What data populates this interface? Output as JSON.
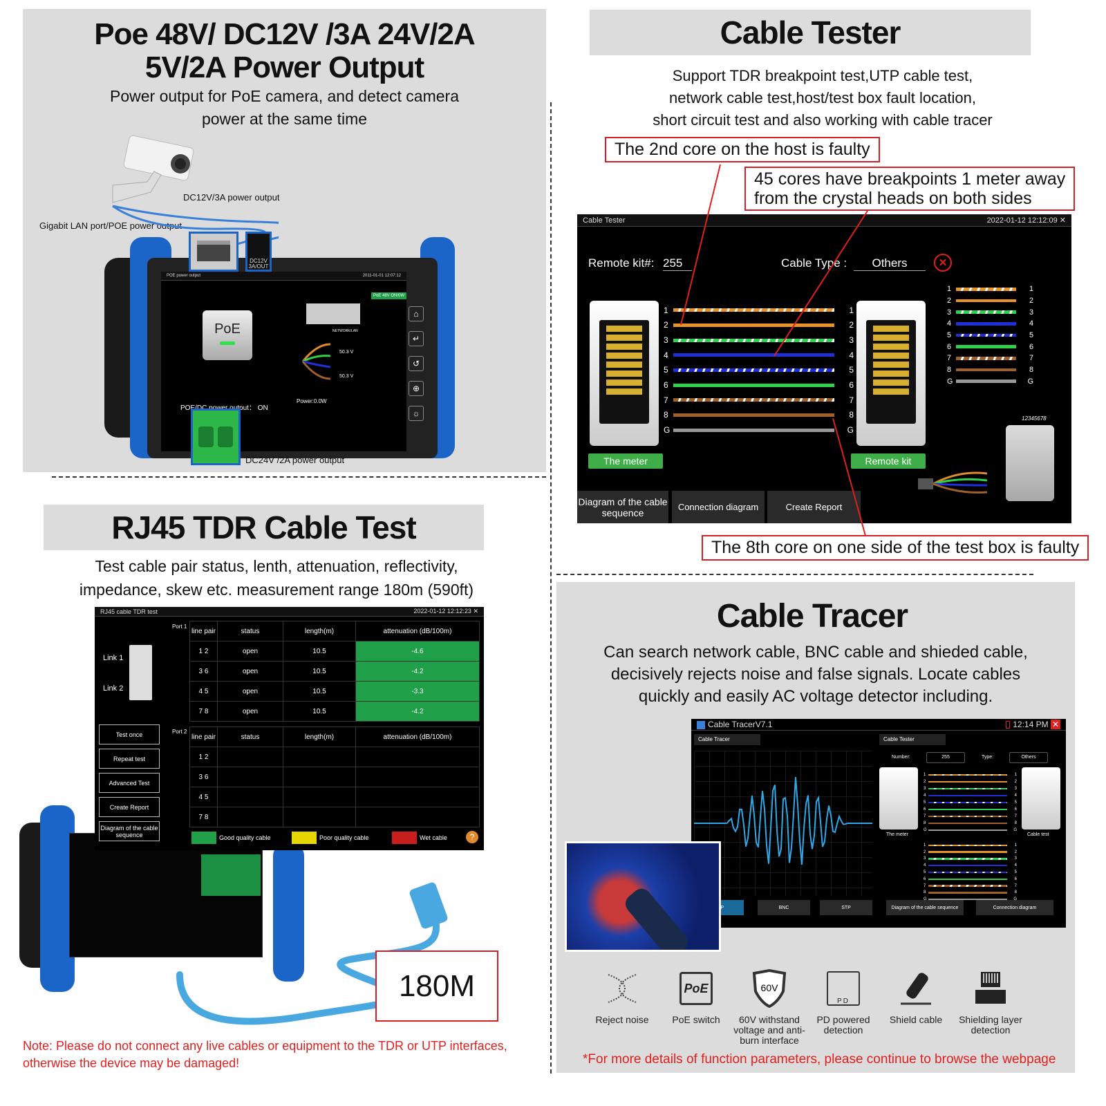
{
  "poe_section": {
    "title_line1": "Poe  48V/ DC12V /3A  24V/2A",
    "title_line2": "5V/2A  Power Output",
    "subtitle_line1": "Power output for PoE camera, and detect camera",
    "subtitle_line2": "power at the same time",
    "labels": {
      "dc12v": "DC12V/3A power output",
      "gigabit": "Gigabit LAN port/POE power output",
      "dc24v": "DC24V /2A  power output",
      "dc_port": "DC12V 3A/OUT"
    },
    "screen": {
      "title": "POE power output",
      "datetime": "2011-01-01 12:07:12",
      "badge": "PoE 48V ON/0W",
      "poe_button": "PoE",
      "network_label": "NETWORK/LAN",
      "voltage1": "50.3 V",
      "voltage2": "50.3 V",
      "power": "Power:0.0W",
      "output_status": "POE/DC power output： ON"
    }
  },
  "cable_tester": {
    "title": "Cable Tester",
    "desc_line1": "Support TDR breakpoint test,UTP cable test,",
    "desc_line2": "network cable test,host/test box fault location,",
    "desc_line3": "short circuit test and also working with cable tracer",
    "callout1": "The 2nd core on  the host is faulty",
    "callout2_line1": "45 cores have breakpoints 1 meter away",
    "callout2_line2": "from the crystal heads on both sides",
    "callout3": "The 8th core on one side of the test box is faulty",
    "screen": {
      "title": "Cable Tester",
      "datetime": "2022-01-12 12:12:09",
      "remote_kit_label": "Remote kit#:",
      "remote_kit_value": "255",
      "cable_type_label": "Cable Type :",
      "cable_type_value": "Others",
      "pins": [
        "1",
        "2",
        "3",
        "4",
        "5",
        "6",
        "7",
        "8",
        "G"
      ],
      "the_meter": "The meter",
      "remote_kit": "Remote kit",
      "btn_sequence": "Diagram of the cable sequence",
      "btn_connection": "Connection diagram",
      "btn_report": "Create Report",
      "plug_label": "12345678"
    }
  },
  "tdr_section": {
    "title": "RJ45 TDR Cable  Test",
    "desc_line1": "Test cable pair status, lenth, attenuation, reflectivity,",
    "desc_line2": "impedance, skew etc. measurement range 180m (590ft)",
    "screen": {
      "title": "RJ45 cable TDR test",
      "datetime": "2022-01-12 12:12:23",
      "link1": "Link 1",
      "link2": "Link 2",
      "port1": "Port 1",
      "port2": "Port 2",
      "columns": [
        "line pair",
        "status",
        "length(m)",
        "attenuation (dB/100m)"
      ],
      "port1_rows": [
        {
          "pair": "1 2",
          "status": "open",
          "length": "10.5",
          "attenuation": "-4.6"
        },
        {
          "pair": "3 6",
          "status": "open",
          "length": "10.5",
          "attenuation": "-4.2"
        },
        {
          "pair": "4 5",
          "status": "open",
          "length": "10.5",
          "attenuation": "-3.3"
        },
        {
          "pair": "7 8",
          "status": "open",
          "length": "10.5",
          "attenuation": "-4.2"
        }
      ],
      "port2_rows": [
        {
          "pair": "1 2"
        },
        {
          "pair": "3 6"
        },
        {
          "pair": "4 5"
        },
        {
          "pair": "7 8"
        }
      ],
      "buttons": [
        "Test once",
        "Repeat test",
        "Advanced Test",
        "Create Report",
        "Diagram of the cable sequence"
      ],
      "legend": [
        {
          "label": "Good quality cable",
          "color": "#1fa049"
        },
        {
          "label": "Poor quality cable",
          "color": "#e8d600"
        },
        {
          "label": "Wet cable",
          "color": "#c81e1e"
        }
      ]
    },
    "range_label": "180M",
    "note_line1": "Note: Please do not connect any live cables or equipment to the TDR or UTP interfaces,",
    "note_line2": "otherwise the device may be damaged!"
  },
  "tracer_section": {
    "title": "Cable Tracer",
    "desc_line1": "Can search network cable, BNC cable and shieded cable,",
    "desc_line2": "decisively rejects noise and false signals. Locate cables",
    "desc_line3": "quickly and easily AC voltage detector including.",
    "screen": {
      "app_title": "Cable TracerV7.1",
      "time": "12:14 PM",
      "tab_tracer": "Cable Tracer",
      "tab_tester": "Cable Tester",
      "number_label": "Number:",
      "number_value": "255",
      "type_label": "Type:",
      "type_value": "Others",
      "the_meter": "The meter",
      "cable_test": "Cable test",
      "buttons_left": [
        "UTP",
        "BNC",
        "STP"
      ],
      "buttons_right": [
        "Diagram of the cable sequence",
        "Connection diagram"
      ]
    },
    "features": [
      {
        "icon": "reject-noise-icon",
        "label": "Reject noise"
      },
      {
        "icon": "poe-switch-icon",
        "label": "PoE switch"
      },
      {
        "icon": "shield-60v-icon",
        "label": "60V withstand voltage and anti-burn interface"
      },
      {
        "icon": "pd-port-icon",
        "label": "PD powered detection"
      },
      {
        "icon": "shield-cable-icon",
        "label": "Shield cable"
      },
      {
        "icon": "shielding-layer-icon",
        "label": "Shielding layer detection"
      }
    ],
    "footnote": "*For more details of function parameters, please continue to browse the webpage"
  },
  "colors": {
    "accent_red": "#e0201f",
    "good_green": "#1fa049",
    "device_blue": "#1b64c8",
    "panel_grey": "#dcdcdc"
  }
}
